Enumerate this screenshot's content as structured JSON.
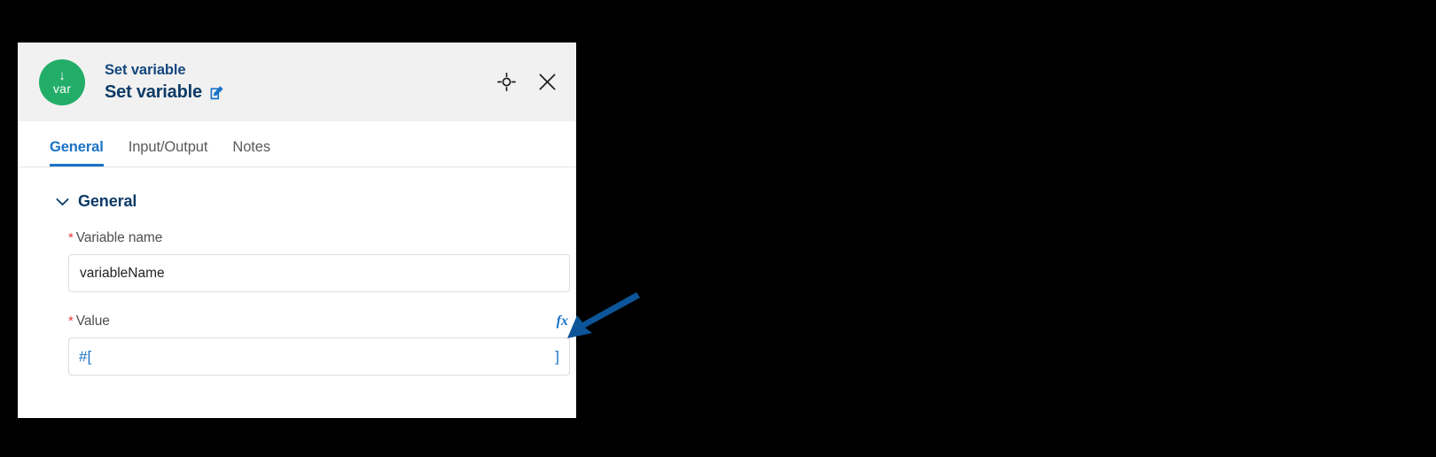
{
  "panel": {
    "header": {
      "icon_name": "var",
      "icon_arrow": "↓",
      "icon_color": "#22ae68",
      "subtitle": "Set variable",
      "title": "Set variable",
      "edit_icon": "edit-pencil-icon",
      "focus_icon": "focus-target-icon",
      "close_icon": "close-x-icon"
    },
    "tabs": [
      {
        "label": "General",
        "active": true
      },
      {
        "label": "Input/Output",
        "active": false
      },
      {
        "label": "Notes",
        "active": false
      }
    ],
    "section": {
      "chevron_icon": "chevron-down-icon",
      "title": "General"
    },
    "fields": [
      {
        "label": "Variable name",
        "required_marker": "*",
        "value": "variableName",
        "placeholder": "",
        "has_fx": false
      },
      {
        "label": "Value",
        "required_marker": "*",
        "fx_label": "fx",
        "expr_open": "#[",
        "expr_close": "]",
        "has_fx": true
      }
    ]
  },
  "annotation": {
    "name": "pointer-arrow",
    "color": "#0d5599",
    "points_to": "fx"
  },
  "colors": {
    "accent_blue": "#1a73c7",
    "title_navy": "#0d3b66",
    "required_red": "#e53935",
    "icon_green": "#22ae68",
    "header_bg": "#f1f1f1"
  }
}
